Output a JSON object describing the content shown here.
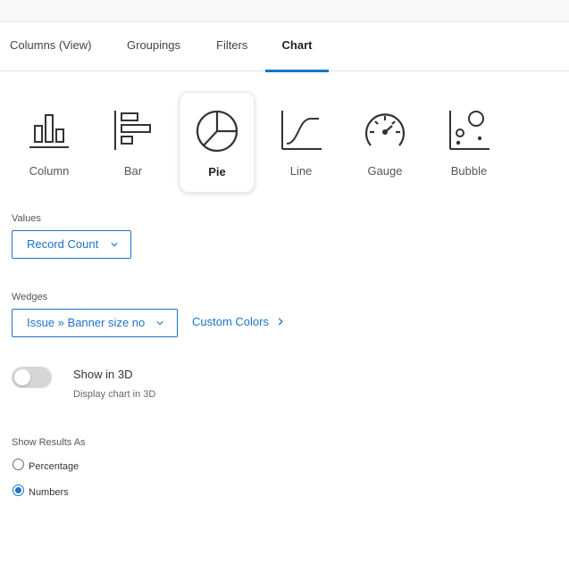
{
  "tabs": [
    {
      "label": "Columns (View)",
      "active": false
    },
    {
      "label": "Groupings",
      "active": false
    },
    {
      "label": "Filters",
      "active": false
    },
    {
      "label": "Chart",
      "active": true
    }
  ],
  "chart_types": [
    {
      "label": "Column",
      "icon": "column-chart-icon"
    },
    {
      "label": "Bar",
      "icon": "bar-chart-icon"
    },
    {
      "label": "Pie",
      "icon": "pie-chart-icon",
      "selected": true
    },
    {
      "label": "Line",
      "icon": "line-chart-icon"
    },
    {
      "label": "Gauge",
      "icon": "gauge-chart-icon"
    },
    {
      "label": "Bubble",
      "icon": "bubble-chart-icon"
    }
  ],
  "values": {
    "label": "Values",
    "selected": "Record Count"
  },
  "wedges": {
    "label": "Wedges",
    "selected": "Issue » Banner size no",
    "custom_colors_label": "Custom Colors"
  },
  "show_3d": {
    "title": "Show in 3D",
    "description": "Display chart in 3D",
    "enabled": false
  },
  "results": {
    "label": "Show Results As",
    "options": [
      {
        "label": "Percentage",
        "checked": false
      },
      {
        "label": "Numbers",
        "checked": true
      }
    ]
  },
  "colors": {
    "accent": "#1a73c9",
    "toggle_off": "#d6d6d6"
  }
}
